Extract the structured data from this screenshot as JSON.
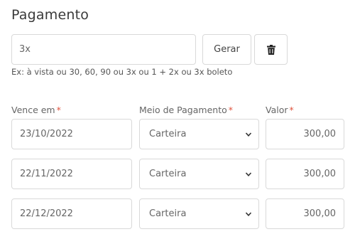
{
  "section": {
    "title": "Pagamento"
  },
  "installments": {
    "value": "3x",
    "hint": "Ex: à vista ou 30, 60, 90 ou 3x ou 1 + 2x ou 3x boleto"
  },
  "buttons": {
    "generate_label": "Gerar",
    "delete_icon": "trash-icon"
  },
  "columns": {
    "due_date": "Vence em",
    "payment_method": "Meio de Pagamento",
    "amount": "Valor",
    "required_marker": "*"
  },
  "rows": [
    {
      "due_date": "23/10/2022",
      "payment_method": "Carteira",
      "amount": "300,00"
    },
    {
      "due_date": "22/11/2022",
      "payment_method": "Carteira",
      "amount": "300,00"
    },
    {
      "due_date": "22/12/2022",
      "payment_method": "Carteira",
      "amount": "300,00"
    }
  ],
  "colors": {
    "required": "#e0533d",
    "border": "#d9d9d9"
  }
}
